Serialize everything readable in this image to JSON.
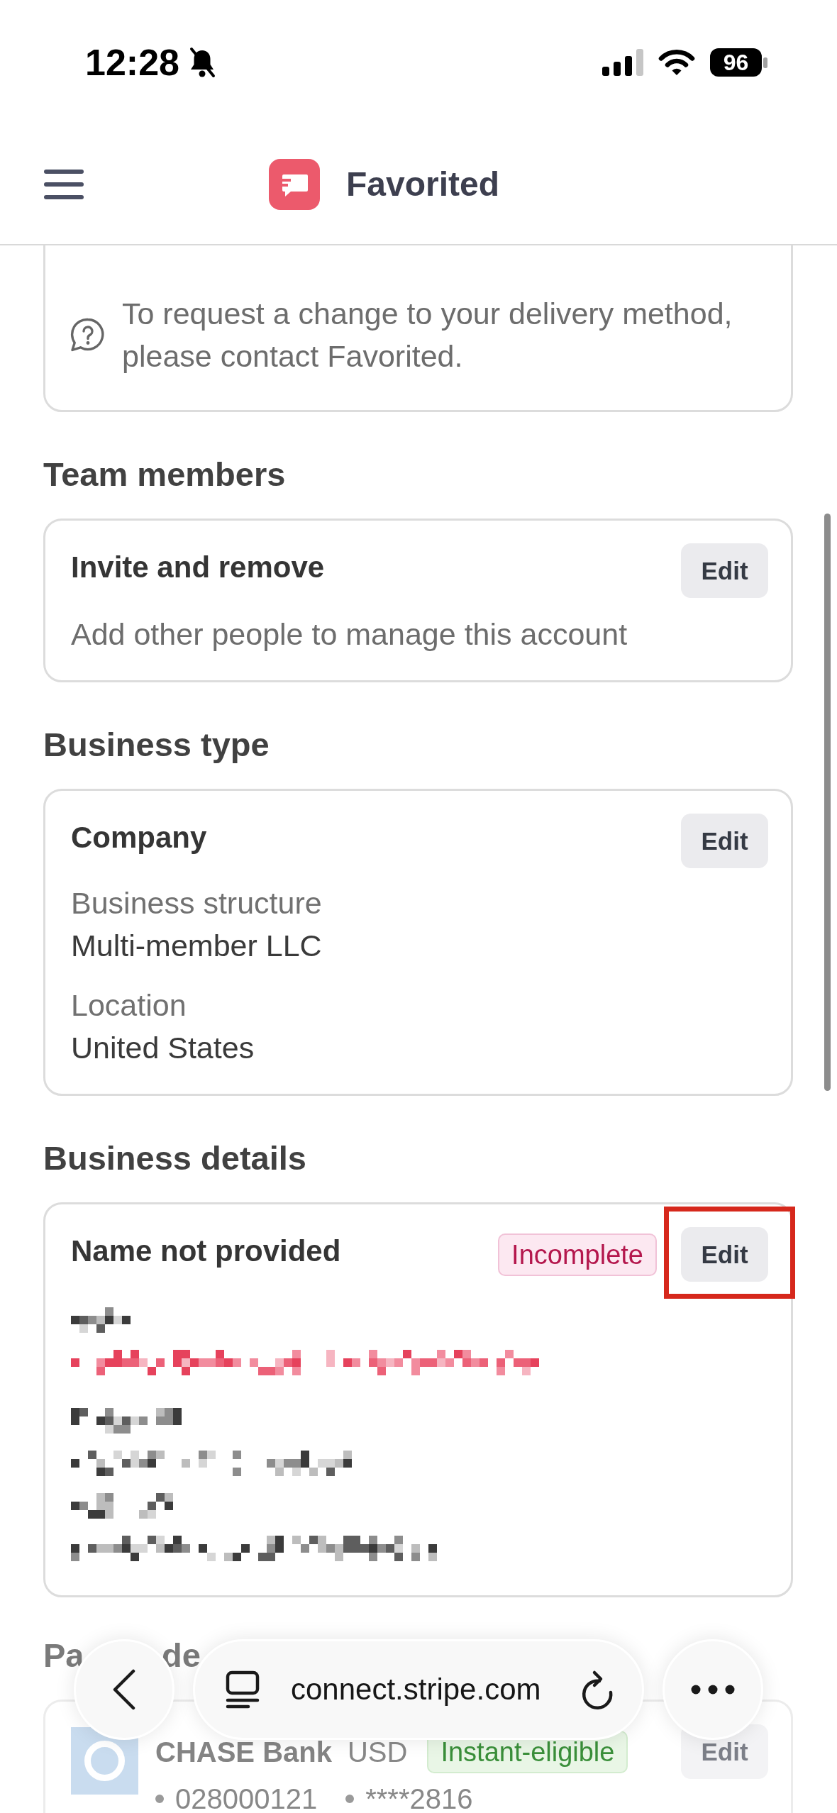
{
  "status_bar": {
    "time": "12:28",
    "silent": true,
    "battery": "96"
  },
  "header": {
    "title": "Favorited"
  },
  "sections": [
    {
      "kind": "notice",
      "text": "To request a change to your delivery method, please contact Favorited."
    },
    {
      "kind": "summary",
      "heading": "Team members",
      "title": "Invite and remove",
      "edit": {
        "label": "Edit",
        "highlighted": false
      },
      "description": "Add other people to manage this account"
    },
    {
      "kind": "fields",
      "heading": "Business type",
      "title": "Company",
      "edit": {
        "label": "Edit",
        "highlighted": false
      },
      "fields": [
        {
          "label": "Business structure",
          "value": "Multi-member LLC"
        },
        {
          "label": "Location",
          "value": "United States"
        }
      ]
    },
    {
      "kind": "redacted",
      "heading": "Business details",
      "title": "Name not provided",
      "badge": {
        "label": "Incomplete",
        "kind": "pending"
      },
      "edit": {
        "label": "Edit",
        "highlighted": true
      },
      "groups": [
        {
          "lines": [
            {
              "kind": "plain"
            },
            {
              "kind": "link"
            }
          ]
        },
        {
          "lines": [
            {
              "kind": "plain"
            },
            {
              "kind": "plain"
            },
            {
              "kind": "plain"
            },
            {
              "kind": "plain"
            }
          ]
        }
      ]
    },
    {
      "kind": "bank",
      "heading_fragments": [
        "Pa",
        "de"
      ],
      "bank": "CHASE Bank",
      "currency": "USD",
      "badge": {
        "label": "Instant-eligible",
        "kind": "success"
      },
      "edit": {
        "label": "Edit",
        "highlighted": false
      },
      "routing": "028000121",
      "account": "****2816"
    }
  ],
  "browser_bar": {
    "url": "connect.stripe.com"
  }
}
